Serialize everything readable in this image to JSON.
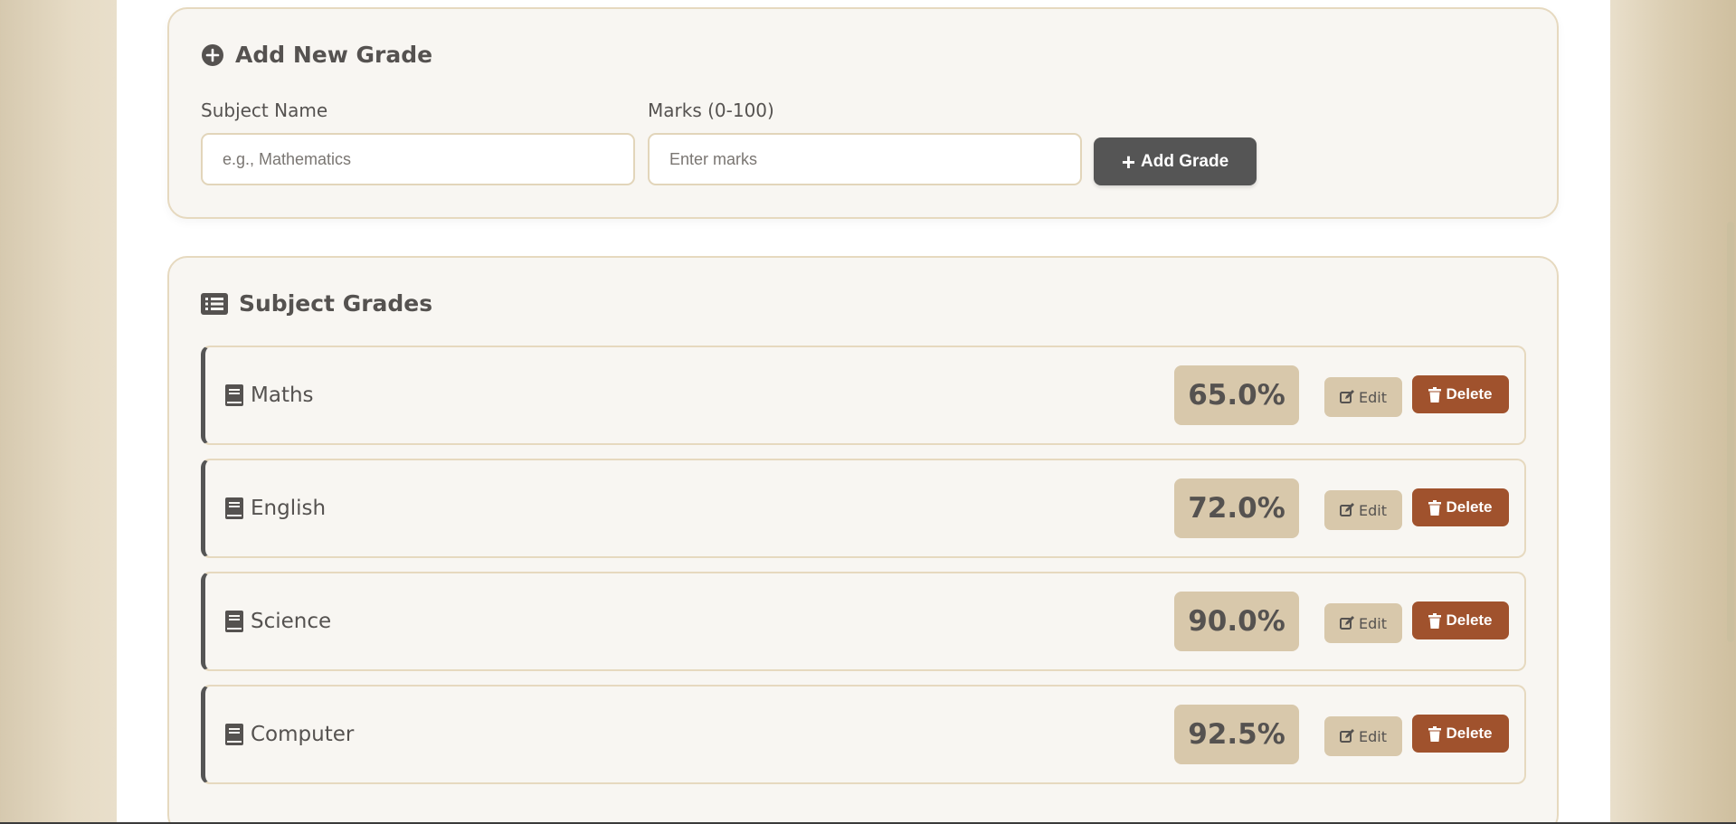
{
  "add_form": {
    "title": "Add New Grade",
    "subject_label": "Subject Name",
    "subject_placeholder": "e.g., Mathematics",
    "marks_label": "Marks (0-100)",
    "marks_placeholder": "Enter marks",
    "add_button_label": "Add Grade",
    "icons": {
      "title": "plus-circle-icon",
      "button": "plus-icon"
    }
  },
  "grades_section": {
    "title": "Subject Grades",
    "icon": "list-icon",
    "edit_label": "Edit",
    "delete_label": "Delete",
    "items": [
      {
        "subject": "Maths",
        "percent": "65.0%"
      },
      {
        "subject": "English",
        "percent": "72.0%"
      },
      {
        "subject": "Science",
        "percent": "90.0%"
      },
      {
        "subject": "Computer",
        "percent": "92.5%"
      }
    ]
  },
  "colors": {
    "accent_dark": "#555555",
    "delete": "#a0522d",
    "badge": "#d8c8ab",
    "card_bg": "#f8f6f2",
    "border": "#e6d9bf"
  }
}
